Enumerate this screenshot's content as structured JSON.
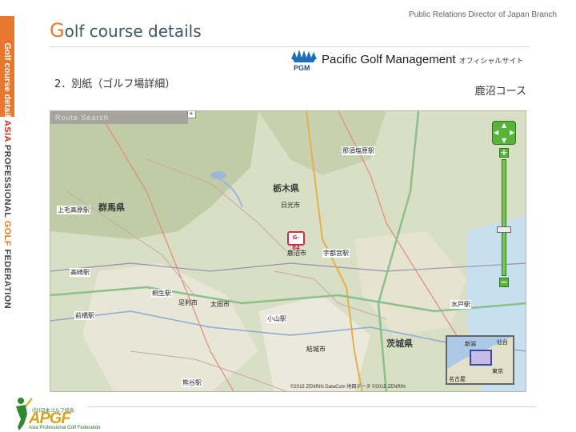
{
  "header": {
    "title_first": "G",
    "title_rest": "olf course details",
    "right_text": "Public Relations Director of Japan Branch"
  },
  "side": {
    "top_text": "Golf course details",
    "word1": "ASIA",
    "word2": "PROFESSIONAL",
    "word3": "GOLF",
    "word4": "FEDERATION"
  },
  "brand": {
    "logo_text": "PGM",
    "name": "Pacific Golf Management",
    "sub": "オフィシャルサイト"
  },
  "subtitle": "2．別紙（ゴルフ場詳細）",
  "course_name": "鹿沼コース",
  "map": {
    "route_search": "Route Search",
    "marker": "G-84",
    "copyright": "©2015 ZENRIN DataCom 地図データ ©2015 ZENRIN",
    "labels": {
      "tochigi": "栃木県",
      "gunma": "群馬県",
      "ibaraki": "茨城県",
      "utsunomiya": "宇都宮駅",
      "nasushiobara": "那須塩原駅",
      "takasaki": "高崎駅",
      "maebashi": "前橋駅",
      "kumagaya": "熊谷駅",
      "oyama": "小山駅",
      "mito": "水戸駅",
      "kamimokogen": "上毛高原駅",
      "kiryu": "桐生駅",
      "nikko": "日光市",
      "kanuma": "鹿沼市",
      "ota": "太田市",
      "ashikaga": "足利市",
      "yuki": "結城市"
    },
    "inset": {
      "niigata": "新潟",
      "tokyo": "東京",
      "nagoya": "名古屋",
      "sendai": "仙台"
    }
  },
  "footer": {
    "org_jp": "(社)日本ゴルフ協会",
    "org_short": "APGF",
    "org_full": "Asia Professional Golf Federation"
  }
}
